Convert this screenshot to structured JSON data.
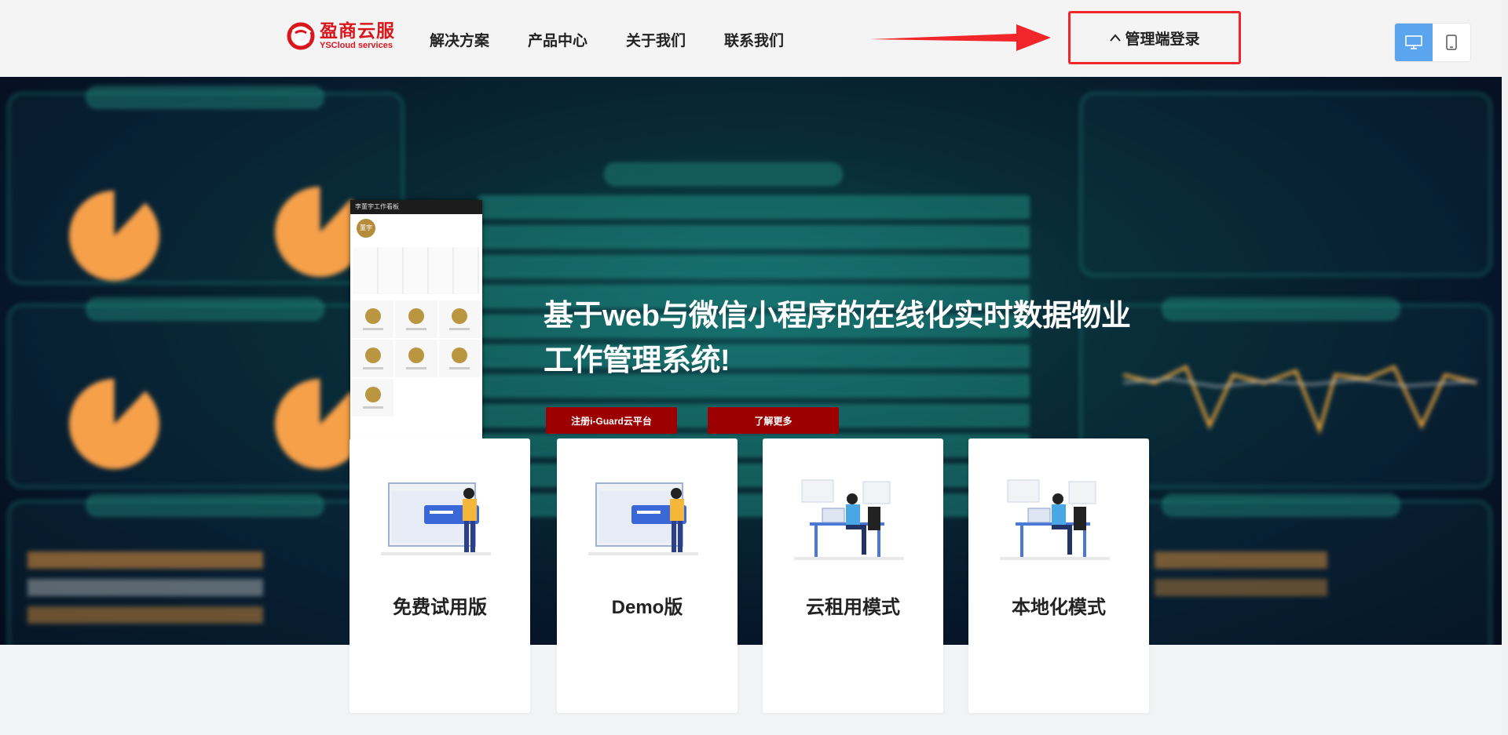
{
  "header": {
    "logo": {
      "name_cn": "盈商云服",
      "name_en": "YSCloud services",
      "icon": "logo-mark-icon",
      "brand_color": "#d9161c"
    },
    "nav": [
      {
        "label": "解决方案"
      },
      {
        "label": "产品中心"
      },
      {
        "label": "关于我们"
      },
      {
        "label": "联系我们"
      }
    ],
    "admin_login": {
      "label": "管理端登录",
      "icon": "chevron-up-icon",
      "highlight_color": "#f0262b"
    },
    "annotation_arrow": {
      "icon": "red-arrow-icon",
      "color": "#f0262b"
    },
    "device_toggle": [
      {
        "icon": "desktop-icon",
        "active": true
      },
      {
        "icon": "mobile-icon",
        "active": false
      }
    ]
  },
  "hero": {
    "title_line1": "基于web与微信小程序的在线化实时数据物业",
    "title_line2": "工作管理系统!",
    "buttons": [
      {
        "label": "注册i-Guard云平台"
      },
      {
        "label": "了解更多"
      }
    ],
    "button_color": "#9c0000",
    "phone": {
      "header": "李董宇工作看板",
      "avatar": "董宇"
    }
  },
  "cards": [
    {
      "label": "免费试用版",
      "icon": "presenter-board-illustration-icon"
    },
    {
      "label": "Demo版",
      "icon": "presenter-board-illustration-icon"
    },
    {
      "label": "云租用模式",
      "icon": "developer-desk-illustration-icon"
    },
    {
      "label": "本地化模式",
      "icon": "developer-desk-illustration-icon"
    }
  ]
}
